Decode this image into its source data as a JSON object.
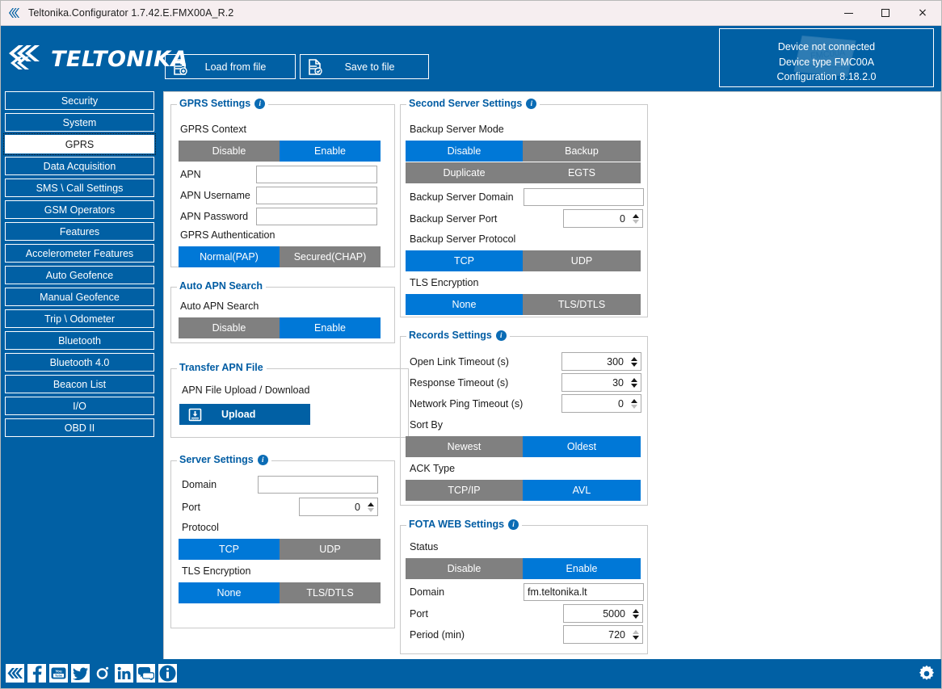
{
  "window": {
    "title": "Teltonika.Configurator 1.7.42.E.FMX00A_R.2",
    "app_icon": "teltonika-chevrons-icon",
    "minimize_label": "",
    "maximize_label": "",
    "close_label": "×"
  },
  "header": {
    "brand": "TELTONIKA",
    "load_button": "Load from file",
    "save_button": "Save to file",
    "device": {
      "connection_status": "Device not connected",
      "type_line": "Device type  FMC00A",
      "configuration_line": "Configuration  8.18.2.0"
    }
  },
  "sidebar": {
    "items": [
      {
        "label": "Security",
        "active": false
      },
      {
        "label": "System",
        "active": false
      },
      {
        "label": "GPRS",
        "active": true
      },
      {
        "label": "Data Acquisition",
        "active": false
      },
      {
        "label": "SMS \\ Call Settings",
        "active": false
      },
      {
        "label": "GSM Operators",
        "active": false
      },
      {
        "label": "Features",
        "active": false
      },
      {
        "label": "Accelerometer Features",
        "active": false
      },
      {
        "label": "Auto Geofence",
        "active": false
      },
      {
        "label": "Manual Geofence",
        "active": false
      },
      {
        "label": "Trip \\ Odometer",
        "active": false
      },
      {
        "label": "Bluetooth",
        "active": false
      },
      {
        "label": "Bluetooth 4.0",
        "active": false
      },
      {
        "label": "Beacon List",
        "active": false
      },
      {
        "label": "I/O",
        "active": false
      },
      {
        "label": "OBD II",
        "active": false
      }
    ]
  },
  "gprs_settings": {
    "title": "GPRS Settings",
    "context_label": "GPRS Context",
    "context_options": [
      "Disable",
      "Enable"
    ],
    "context_selected": "Enable",
    "apn_label": "APN",
    "apn_value": "",
    "apn_username_label": "APN Username",
    "apn_username_value": "",
    "apn_password_label": "APN Password",
    "apn_password_value": "",
    "auth_label": "GPRS Authentication",
    "auth_options": [
      "Normal(PAP)",
      "Secured(CHAP)"
    ],
    "auth_selected": "Normal(PAP)"
  },
  "auto_apn_search": {
    "title": "Auto APN Search",
    "label": "Auto APN Search",
    "options": [
      "Disable",
      "Enable"
    ],
    "selected": "Enable"
  },
  "transfer_apn_file": {
    "title": "Transfer APN File",
    "label": "APN File Upload / Download",
    "upload_button": "Upload"
  },
  "server_settings": {
    "title": "Server Settings",
    "domain_label": "Domain",
    "domain_value": "",
    "port_label": "Port",
    "port_value": "0",
    "protocol_label": "Protocol",
    "protocol_options": [
      "TCP",
      "UDP"
    ],
    "protocol_selected": "TCP",
    "tls_label": "TLS Encryption",
    "tls_options": [
      "None",
      "TLS/DTLS"
    ],
    "tls_selected": "None"
  },
  "second_server_settings": {
    "title": "Second Server Settings",
    "mode_label": "Backup Server Mode",
    "mode_options": [
      "Disable",
      "Backup",
      "Duplicate",
      "EGTS"
    ],
    "mode_selected": "Disable",
    "domain_label": "Backup Server Domain",
    "domain_value": "",
    "port_label": "Backup Server Port",
    "port_value": "0",
    "protocol_label": "Backup Server Protocol",
    "protocol_options": [
      "TCP",
      "UDP"
    ],
    "protocol_selected": "TCP",
    "tls_label": "TLS Encryption",
    "tls_options": [
      "None",
      "TLS/DTLS"
    ],
    "tls_selected": "None"
  },
  "records_settings": {
    "title": "Records Settings",
    "open_link_label": "Open Link Timeout   (s)",
    "open_link_value": "300",
    "response_label": "Response Timeout   (s)",
    "response_value": "30",
    "ping_label": "Network Ping Timeout   (s)",
    "ping_value": "0",
    "sort_label": "Sort By",
    "sort_options": [
      "Newest",
      "Oldest"
    ],
    "sort_selected": "Oldest",
    "ack_label": "ACK Type",
    "ack_options": [
      "TCP/IP",
      "AVL"
    ],
    "ack_selected": "AVL"
  },
  "fota_web_settings": {
    "title": "FOTA WEB Settings",
    "status_label": "Status",
    "status_options": [
      "Disable",
      "Enable"
    ],
    "status_selected": "Enable",
    "domain_label": "Domain",
    "domain_value": "fm.teltonika.lt",
    "port_label": "Port",
    "port_value": "5000",
    "period_label": "Period (min)",
    "period_value": "720"
  },
  "footer": {
    "socials": [
      "teltonika-logo-icon",
      "facebook-icon",
      "youtube-icon",
      "twitter-icon",
      "instagram-icon",
      "linkedin-icon",
      "forum-icon",
      "info-icon"
    ],
    "settings_icon": "gear-icon"
  },
  "colors": {
    "brand_blue": "#0160a4",
    "accent_blue": "#0078d7",
    "toggle_gray": "#808080",
    "legend_blue": "#005ca3",
    "panel_bg": "#ffffff"
  }
}
